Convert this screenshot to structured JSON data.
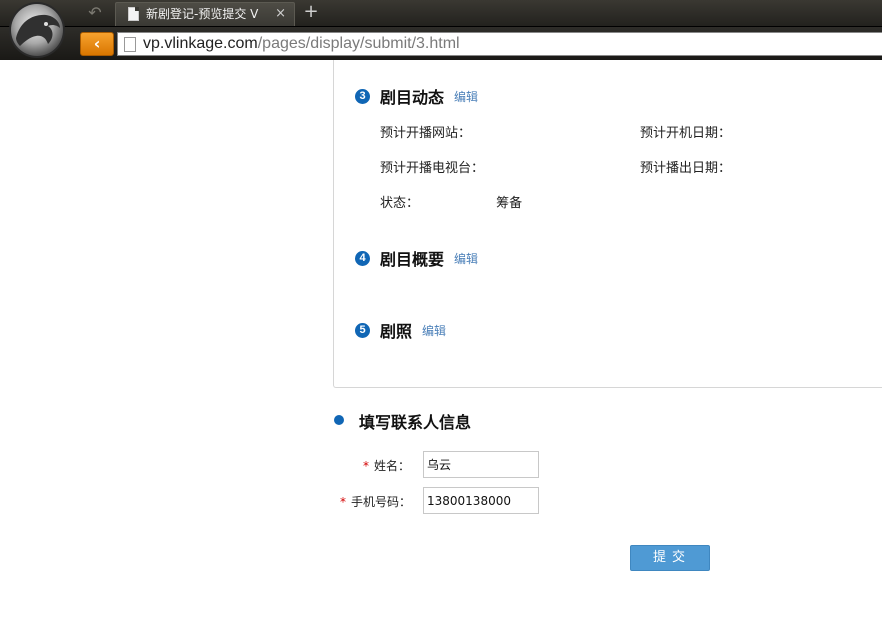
{
  "browser": {
    "tab_title": "新剧登记-预览提交 V",
    "tab_close": "×",
    "new_tab": "+",
    "back_top": "↶",
    "back": "‹",
    "url_host": "vp.vlinkage.com",
    "url_path": "/pages/display/submit/3.html"
  },
  "sections": {
    "s3": {
      "num": "3",
      "title": "剧目动态",
      "edit": "编辑",
      "fields": {
        "site_label": "预计开播网站：",
        "site_value": "",
        "shoot_date_label": "预计开机日期：",
        "shoot_date_value": "",
        "tv_label": "预计开播电视台：",
        "tv_value": "",
        "air_date_label": "预计播出日期：",
        "air_date_value": "",
        "status_label": "状态：",
        "status_value": "筹备"
      }
    },
    "s4": {
      "num": "4",
      "title": "剧目概要",
      "edit": "编辑"
    },
    "s5": {
      "num": "5",
      "title": "剧照",
      "edit": "编辑"
    }
  },
  "contact": {
    "title": "填写联系人信息",
    "required_mark": "*",
    "name_label": "姓名：",
    "name_value": "乌云",
    "phone_label": "手机号码：",
    "phone_value": "13800138000"
  },
  "submit_label": "提交",
  "colors": {
    "accent": "#1066b5",
    "link": "#4a7fb8",
    "button": "#4f9ad4",
    "required": "#d40000",
    "browser_orange": "#f08a00"
  }
}
